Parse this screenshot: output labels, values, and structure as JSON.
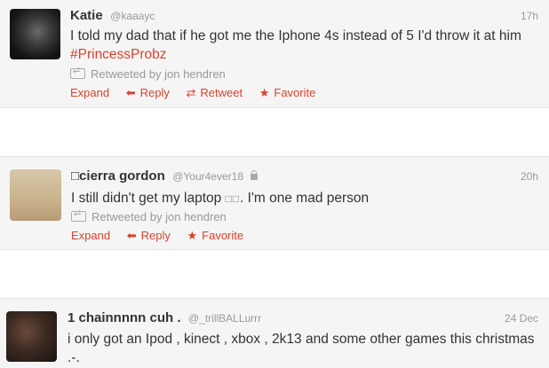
{
  "tweets": [
    {
      "name": "Katie",
      "handle": "@kaaayc",
      "time": "17h",
      "text": "I told my dad that if he got me the Iphone 4s instead of 5 I'd throw it at him ",
      "hashtag": "#PrincessProbz",
      "retweeted_by": "Retweeted by jon hendren",
      "actions": {
        "expand": "Expand",
        "reply": "Reply",
        "retweet": "Retweet",
        "favorite": "Favorite"
      }
    },
    {
      "name": "□cierra gordon",
      "handle": "@Your4ever18",
      "time": "20h",
      "text_before": "I still didn't get my laptop ",
      "text_boxes": "□□",
      "text_after": ". I'm one mad person",
      "retweeted_by": "Retweeted by jon hendren",
      "actions": {
        "expand": "Expand",
        "reply": "Reply",
        "favorite": "Favorite"
      }
    },
    {
      "name": "1 chainnnnn cuh .",
      "handle": "@_trillBALLurrr",
      "time": "24 Dec",
      "text": "i only got an Ipod , kinect , xbox , 2k13 and some other games this christmas .-."
    }
  ],
  "icons": {
    "reply": "reply-arrow-icon",
    "retweet": "retweet-icon",
    "favorite": "star-icon",
    "lock": "lock-icon"
  },
  "colors": {
    "accent": "#d8422c",
    "muted": "#999999",
    "text": "#333333",
    "card_bg": "#f5f5f5"
  }
}
